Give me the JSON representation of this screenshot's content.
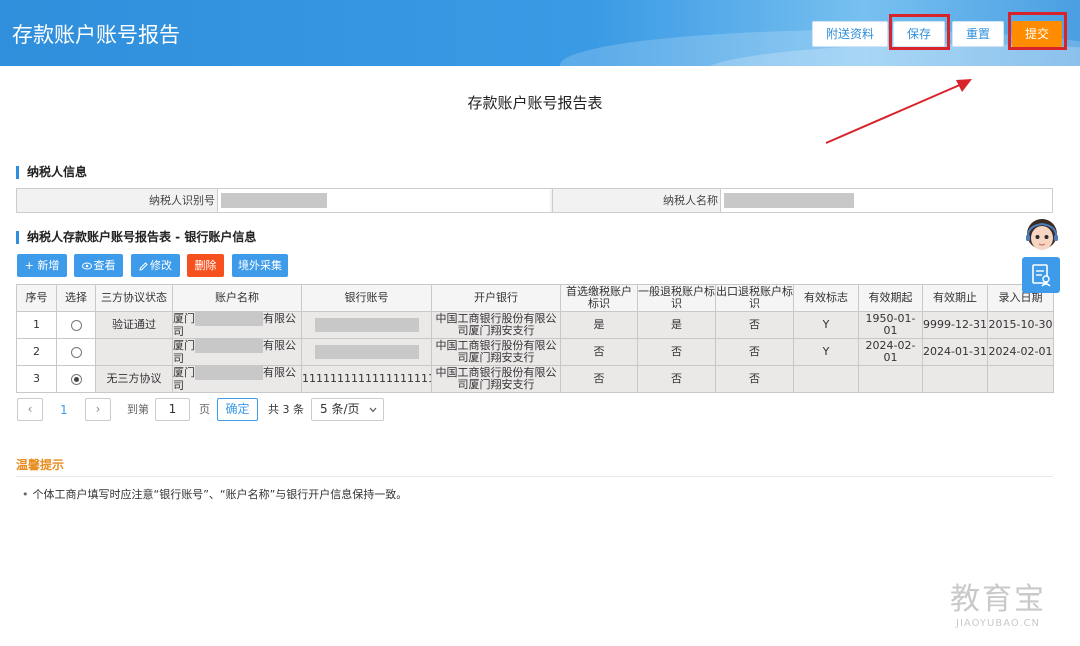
{
  "header": {
    "title": "存款账户账号报告",
    "buttons": {
      "attach": "附送资料",
      "save": "保存",
      "reset": "重置",
      "submit": "提交"
    }
  },
  "form_title": "存款账户账号报告表",
  "taxpayer": {
    "section_title": "纳税人信息",
    "id_label": "纳税人识别号",
    "name_label": "纳税人名称"
  },
  "bank": {
    "section_title": "纳税人存款账户账号报告表 - 银行账户信息",
    "toolbar": {
      "add": "+ 新增",
      "view": "查看",
      "edit": "修改",
      "delete": "删除",
      "overseas": "境外采集"
    },
    "columns": [
      "序号",
      "选择",
      "三方协议状态",
      "账户名称",
      "银行账号",
      "开户银行",
      "首选缴税账户标识",
      "一般退税账户标识",
      "出口退税账户标识",
      "有效标志",
      "有效期起",
      "有效期止",
      "录入日期"
    ],
    "rows": [
      {
        "no": "1",
        "selected": false,
        "status": "验证通过",
        "name_prefix": "厦门",
        "name_suffix": "有限公司",
        "account": "",
        "bank": "中国工商银行股份有限公司厦门翔安支行",
        "pref": "是",
        "general": "是",
        "export": "否",
        "valid": "Y",
        "start": "1950-01-01",
        "end": "9999-12-31",
        "entry": "2015-10-30"
      },
      {
        "no": "2",
        "selected": false,
        "status": "",
        "name_prefix": "厦门",
        "name_suffix": "有限公司",
        "account": "",
        "bank": "中国工商银行股份有限公司厦门翔安支行",
        "pref": "否",
        "general": "否",
        "export": "否",
        "valid": "Y",
        "start": "2024-02-01",
        "end": "2024-01-31",
        "entry": "2024-02-01"
      },
      {
        "no": "3",
        "selected": true,
        "status": "无三方协议",
        "name_prefix": "厦门",
        "name_suffix": "有限公司",
        "account": "1111111111111111111",
        "bank": "中国工商银行股份有限公司厦门翔安支行",
        "pref": "否",
        "general": "否",
        "export": "否",
        "valid": "",
        "start": "",
        "end": "",
        "entry": ""
      }
    ]
  },
  "pager": {
    "prev": "‹",
    "page": "1",
    "next": "›",
    "goto_label": "到第",
    "goto_value": "1",
    "page_unit": "页",
    "confirm": "确定",
    "total": "共 3 条",
    "size_selected": "5 条/页"
  },
  "tips": {
    "title": "温馨提示",
    "text": "个体工商户填写时应注意“银行账号”、“账户名称”与银行开户信息保持一致。"
  },
  "watermark": {
    "main": "教育宝",
    "sub": "JIAOYUBAO.CN"
  },
  "icons": {
    "view": "eye-icon",
    "edit": "pencil-icon",
    "side": "document-user-icon",
    "avatar": "customer-service-avatar"
  },
  "colors": {
    "primary": "#2f8fdc",
    "submit": "#ff8c00",
    "delete": "#f7501f",
    "highlight": "#d9232b",
    "tips": "#e88c1e"
  }
}
